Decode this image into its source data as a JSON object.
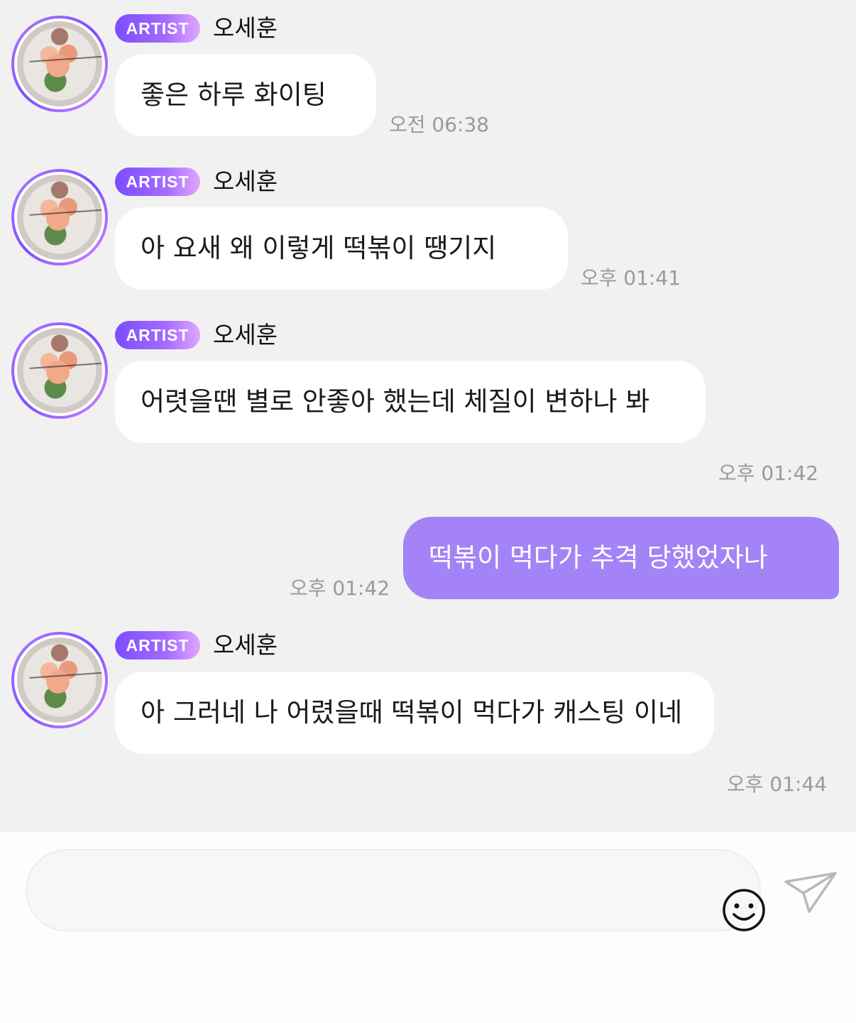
{
  "messages": [
    {
      "badge": "ARTIST",
      "sender": "오세훈",
      "text": "좋은 하루 화이팅",
      "time": "오전 06:38"
    },
    {
      "badge": "ARTIST",
      "sender": "오세훈",
      "text": "아 요새 왜 이렇게 떡볶이 땡기지",
      "time": "오후 01:41"
    },
    {
      "badge": "ARTIST",
      "sender": "오세훈",
      "text": "어렷을땐 별로 안좋아 했는데 체질이 변하나 봐",
      "time": "오후 01:42"
    },
    {
      "mine": true,
      "text": "떡볶이 먹다가 추격 당했었자나",
      "time": "오후 01:42"
    },
    {
      "badge": "ARTIST",
      "sender": "오세훈",
      "text": "아 그러네 나 어렸을때 떡볶이 먹다가 캐스팅 이네",
      "time": "오후 01:44"
    }
  ],
  "composer": {
    "placeholder": "",
    "emoji_icon": "smiley-icon",
    "send_icon": "paper-plane-icon"
  },
  "colors": {
    "background": "#f1f1f2",
    "bubble_other": "#ffffff",
    "bubble_mine": "#a383f6",
    "badge_start": "#7b4dff",
    "badge_end": "#e2a6ff",
    "time_text": "#9a9a9a"
  }
}
